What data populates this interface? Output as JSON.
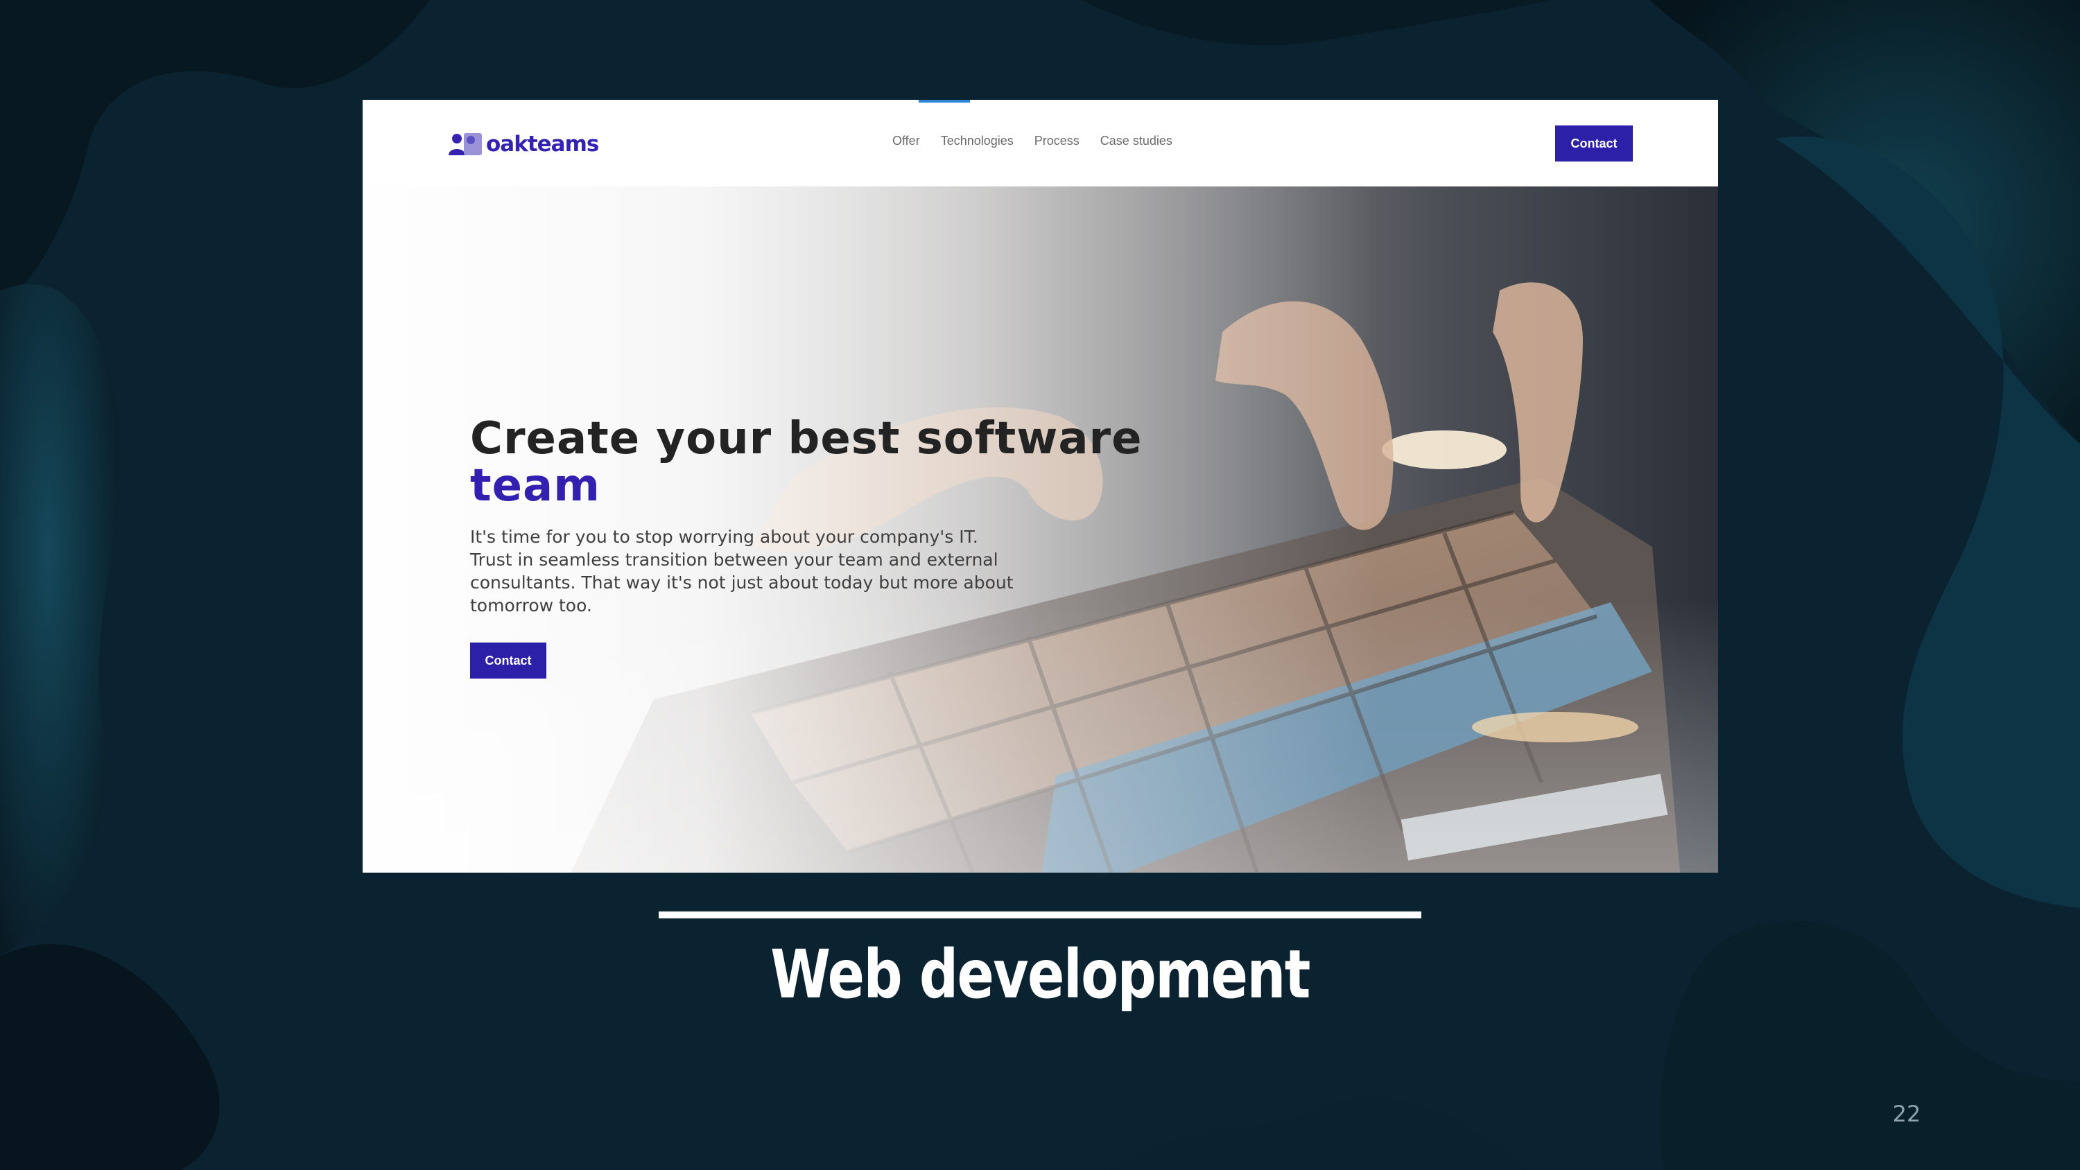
{
  "slide": {
    "caption": "Web development",
    "page_number": "22"
  },
  "website": {
    "logo_text": "oakteams",
    "nav": {
      "items": [
        "Offer",
        "Technologies",
        "Process",
        "Case studies"
      ],
      "contact_label": "Contact"
    },
    "hero": {
      "title_line1": "Create your best software",
      "title_line2": "team",
      "description": "It's time for you to stop worrying about your company's IT. Trust in seamless transition between your team and external consultants. That way it's not just about today but more about tomorrow too.",
      "contact_label": "Contact"
    }
  },
  "colors": {
    "slide_background": "#0c2330",
    "brand_primary": "#2c1fa8",
    "brand_accent_text": "#3320b0",
    "nav_indicator": "#2f86d6"
  },
  "icons": {
    "logo": "people-logo-icon"
  }
}
